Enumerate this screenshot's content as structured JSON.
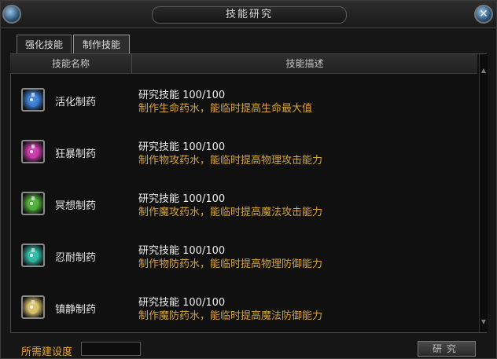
{
  "window": {
    "title": "技能研究"
  },
  "tabs": [
    {
      "label": "强化技能"
    },
    {
      "label": "制作技能"
    }
  ],
  "table": {
    "headers": [
      "技能名称",
      "技能描述"
    ],
    "rows": [
      {
        "icon": "potion-life-icon",
        "name": "活化制药",
        "level": "研究技能 100/100",
        "desc": "制作生命药水，能临时提高生命最大值",
        "color": "#3b7fd6"
      },
      {
        "icon": "potion-rage-icon",
        "name": "狂暴制药",
        "level": "研究技能 100/100",
        "desc": "制作物攻药水，能临时提高物理攻击能力",
        "color": "#c63aa8"
      },
      {
        "icon": "potion-meditate-icon",
        "name": "冥想制药",
        "level": "研究技能 100/100",
        "desc": "制作魔攻药水，能临时提高魔法攻击能力",
        "color": "#4fae3a"
      },
      {
        "icon": "potion-endure-icon",
        "name": "忍耐制药",
        "level": "研究技能 100/100",
        "desc": "制作物防药水，能临时提高物理防御能力",
        "color": "#2fb7a3"
      },
      {
        "icon": "potion-calm-icon",
        "name": "镇静制药",
        "level": "研究技能 100/100",
        "desc": "制作魔防药水，能临时提高魔法防御能力",
        "color": "#d8c06a"
      }
    ]
  },
  "footer": {
    "required_label": "所需建设度",
    "required_value": "",
    "research_button": "研究"
  }
}
